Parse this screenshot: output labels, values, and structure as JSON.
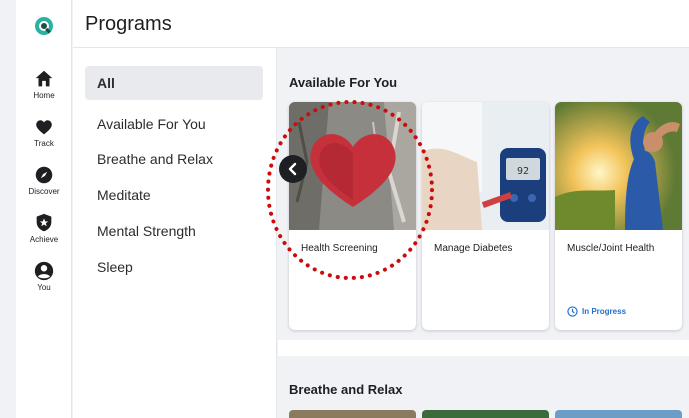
{
  "rail": {
    "items": [
      {
        "label": "Home",
        "icon": "home-icon"
      },
      {
        "label": "Track",
        "icon": "heart-icon"
      },
      {
        "label": "Discover",
        "icon": "compass-icon"
      },
      {
        "label": "Achieve",
        "icon": "shield-icon"
      },
      {
        "label": "You",
        "icon": "person-icon"
      }
    ],
    "logo": "app-logo-icon"
  },
  "header": {
    "title": "Programs"
  },
  "categories": [
    {
      "label": "All",
      "active": true
    },
    {
      "label": "Available For You"
    },
    {
      "label": "Breathe and Relax"
    },
    {
      "label": "Meditate"
    },
    {
      "label": "Mental Strength"
    },
    {
      "label": "Sleep"
    }
  ],
  "sections": [
    {
      "title": "Available For You",
      "cards": [
        {
          "name": "Health Screening",
          "image": "heart-carved-in-tree"
        },
        {
          "name": "Manage Diabetes",
          "image": "glucose-meter"
        },
        {
          "name": "Muscle/Joint Health",
          "image": "person-stretching",
          "status": "In Progress"
        }
      ]
    },
    {
      "title": "Breathe and Relax"
    }
  ],
  "colors": {
    "accent": "#1f6fd1",
    "annotation": "#cc0b0b",
    "background": "#f0f2f5"
  }
}
